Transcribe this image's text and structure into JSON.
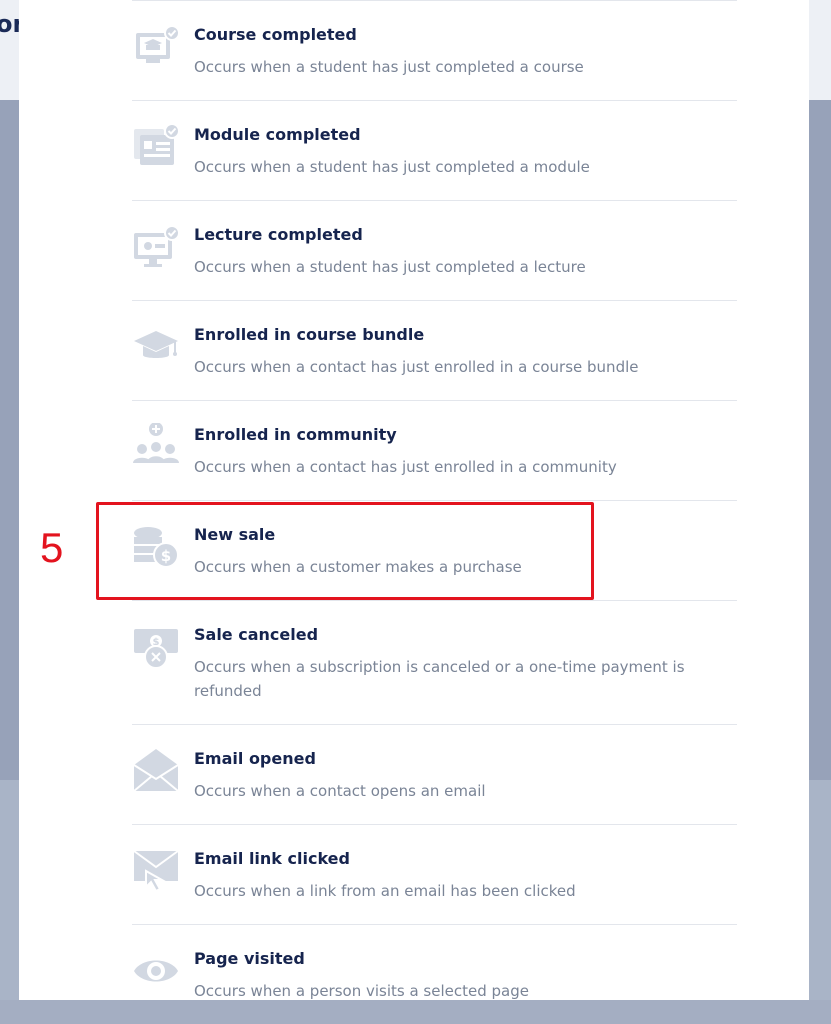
{
  "background": {
    "edge_text": "on"
  },
  "annotation": {
    "step_number": "5",
    "color": "#e3131e"
  },
  "colors": {
    "title": "#16244e",
    "description": "#7a8496",
    "icon": "#d2d8e2"
  },
  "triggers": [
    {
      "title": "Course completed",
      "description": "Occurs when a student has just completed a course",
      "icon": "course-completed-icon"
    },
    {
      "title": "Module completed",
      "description": "Occurs when a student has just completed a module",
      "icon": "module-completed-icon"
    },
    {
      "title": "Lecture completed",
      "description": "Occurs when a student has just completed a lecture",
      "icon": "lecture-completed-icon"
    },
    {
      "title": "Enrolled in course bundle",
      "description": "Occurs when a contact has just enrolled in a course bundle",
      "icon": "graduation-cap-icon"
    },
    {
      "title": "Enrolled in community",
      "description": "Occurs when a contact has just enrolled in a community",
      "icon": "community-icon"
    },
    {
      "title": "New sale",
      "description": "Occurs when a customer makes a purchase",
      "icon": "coins-dollar-icon"
    },
    {
      "title": "Sale canceled",
      "description": "Occurs when a subscription is canceled or a one-time payment is refunded",
      "icon": "sale-canceled-icon"
    },
    {
      "title": "Email opened",
      "description": "Occurs when a contact opens an email",
      "icon": "envelope-open-icon"
    },
    {
      "title": "Email link clicked",
      "description": "Occurs when a link from an email has been clicked",
      "icon": "email-link-click-icon"
    },
    {
      "title": "Page visited",
      "description": "Occurs when a person visits a selected page",
      "icon": "eye-icon"
    }
  ]
}
